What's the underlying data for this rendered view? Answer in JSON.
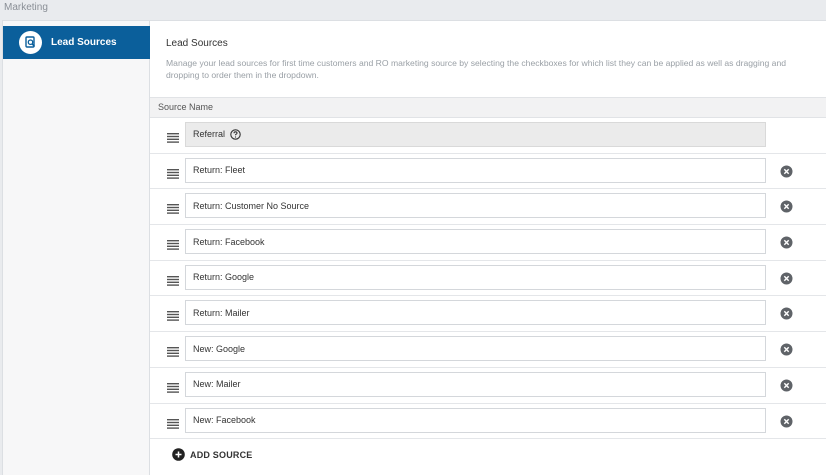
{
  "breadcrumb": "Marketing",
  "sidebar": {
    "items": [
      {
        "label": "Lead Sources",
        "icon": "search-document-icon",
        "active": true
      }
    ]
  },
  "header": {
    "title": "Lead Sources",
    "description": "Manage your lead sources for first time customers and RO marketing source by selecting the checkboxes for which list they can be applied as well as dragging and dropping to order them in the dropdown."
  },
  "table": {
    "column_header": "Source Name",
    "rows": [
      {
        "label": "Referral",
        "readonly": true,
        "removable": false
      },
      {
        "label": "Return: Fleet",
        "readonly": false,
        "removable": true
      },
      {
        "label": "Return: Customer No Source",
        "readonly": false,
        "removable": true
      },
      {
        "label": "Return: Facebook",
        "readonly": false,
        "removable": true
      },
      {
        "label": "Return: Google",
        "readonly": false,
        "removable": true
      },
      {
        "label": "Return: Mailer",
        "readonly": false,
        "removable": true
      },
      {
        "label": "New: Google",
        "readonly": false,
        "removable": true
      },
      {
        "label": "New: Mailer",
        "readonly": false,
        "removable": true
      },
      {
        "label": "New: Facebook",
        "readonly": false,
        "removable": true
      }
    ]
  },
  "actions": {
    "add_source_label": "ADD SOURCE"
  },
  "colors": {
    "accent": "#0b5f9b",
    "remove_icon": "#5f6368"
  }
}
